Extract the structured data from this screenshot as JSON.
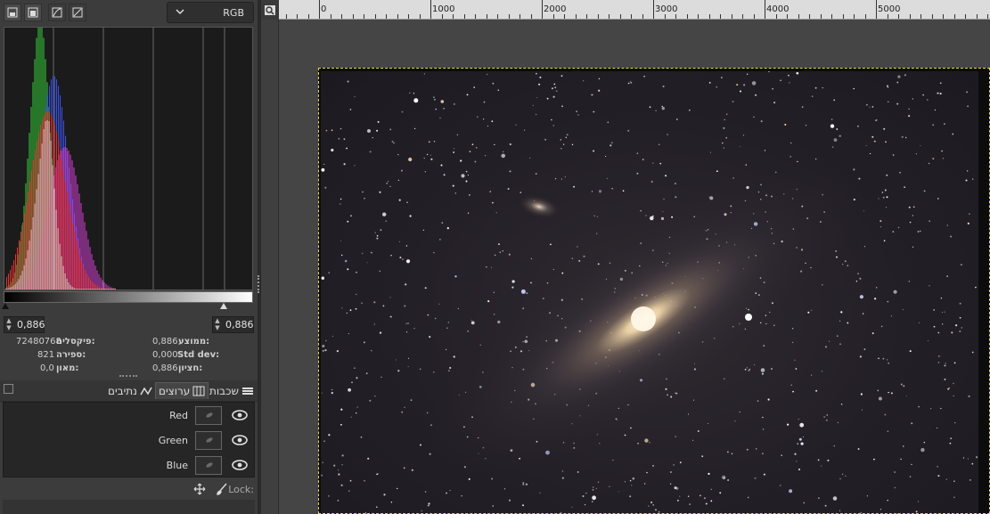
{
  "histogram": {
    "channel_select": {
      "value": "RGB"
    },
    "range": {
      "left": "0,886",
      "right": "0,886"
    },
    "stats": {
      "mean": {
        "label": "ממוצע:",
        "value": "0,886"
      },
      "stddev": {
        "label": "Std dev:",
        "value": "0,000"
      },
      "median": {
        "label": "חציון:",
        "value": "0,886"
      },
      "pixels": {
        "label": "פיקסלים:",
        "value": "72480768"
      },
      "count": {
        "label": "ספירה:",
        "value": "821"
      },
      "percentile": {
        "label": "מאון:",
        "value": "0,0"
      }
    }
  },
  "dock_tabs": [
    {
      "label": "שכבות",
      "icon": "layers-icon"
    },
    {
      "label": "ערוצים",
      "icon": "channels-icon"
    },
    {
      "label": "נתיבים",
      "icon": "paths-icon"
    }
  ],
  "channels": [
    {
      "name": "Red"
    },
    {
      "name": "Green"
    },
    {
      "name": "Blue"
    }
  ],
  "lock": {
    "label": "Lock:"
  },
  "ruler": {
    "labels": [
      "0",
      "1000",
      "2000",
      "3000",
      "4000",
      "5000"
    ]
  },
  "colors": {
    "red": "#e53333",
    "green": "#33d23a",
    "blue": "#3b53e8",
    "magenta": "#d83fd8",
    "selection": "#e8d84a"
  }
}
